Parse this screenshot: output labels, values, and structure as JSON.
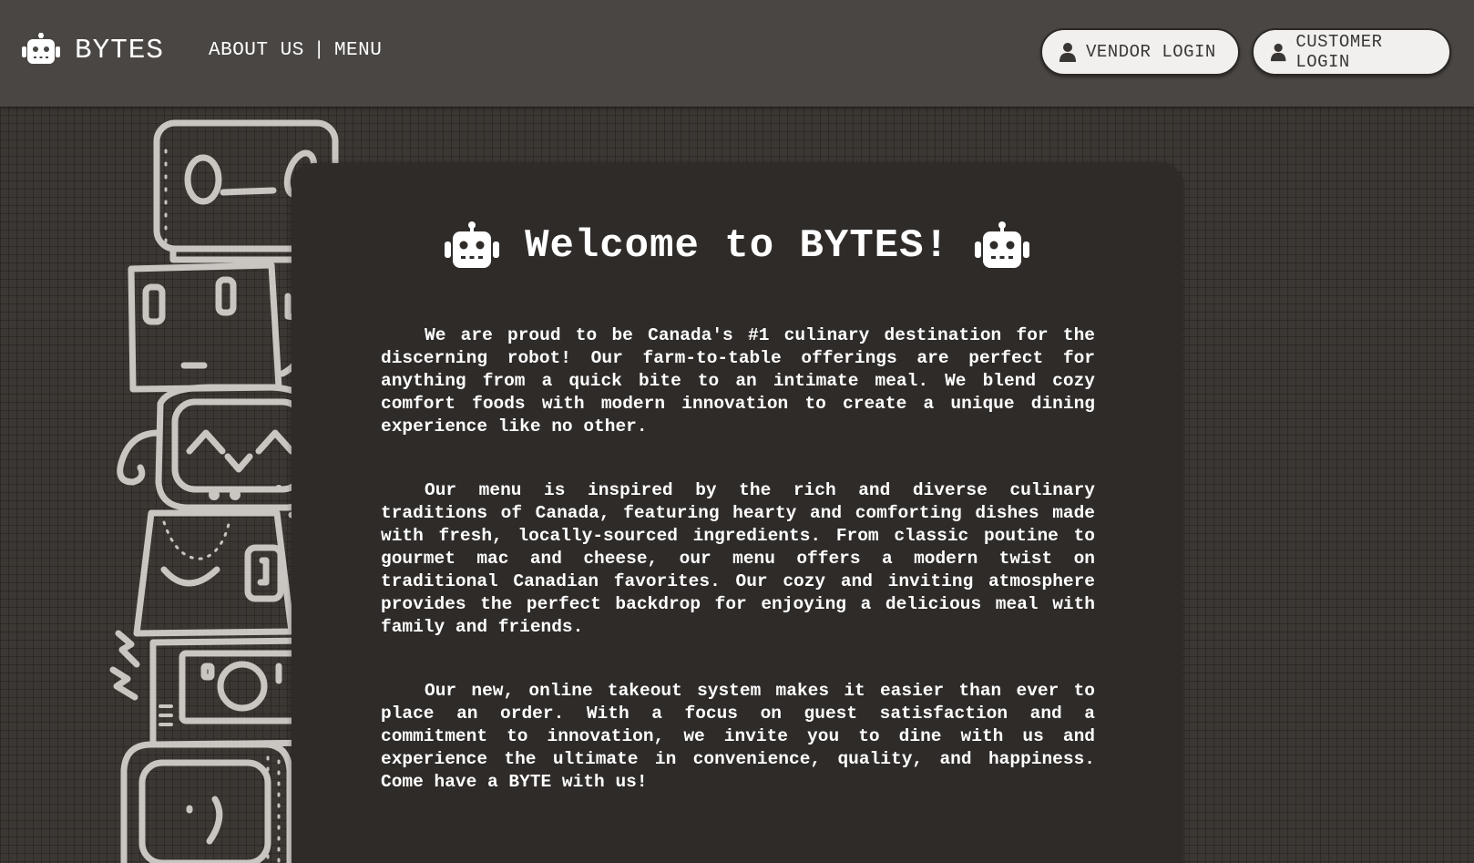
{
  "header": {
    "brand_name": "BYTES",
    "brand_icon": "robot-icon",
    "nav": {
      "about": "ABOUT US",
      "separator": "|",
      "menu": "MENU"
    },
    "vendor_login": "VENDOR LOGIN",
    "customer_login": "CUSTOMER LOGIN",
    "login_icon": "user-icon"
  },
  "main": {
    "title": "Welcome to BYTES!",
    "title_icon": "robot-icon",
    "paragraphs": [
      "We are proud to be Canada's #1 culinary destination for the discerning robot! Our farm-to-table offerings are perfect for anything from a quick bite to an intimate meal. We blend cozy comfort foods with modern innovation to create a unique dining experience like no other.",
      "Our menu is inspired by the rich and diverse culinary traditions of Canada, featuring hearty and comforting dishes made with fresh, locally-sourced ingredients. From classic poutine to gourmet mac and cheese, our menu offers a modern twist on traditional Canadian favorites. Our cozy and inviting atmosphere provides the perfect backdrop for enjoying a delicious meal with family and friends.",
      "Our new, online takeout system makes it easier than ever to place an order. With a focus on guest satisfaction and a commitment to innovation, we invite you to dine with us and experience the ultimate in convenience, quality, and happiness. Come have a BYTE with us!"
    ]
  },
  "decoration": {
    "illustration": "stacked-robots-illustration"
  },
  "colors": {
    "header_bg": "#4a4643",
    "page_bg": "#3b3733",
    "card_bg": "#2f2b29",
    "button_bg": "#f1f0ee",
    "text": "#ffffff"
  }
}
